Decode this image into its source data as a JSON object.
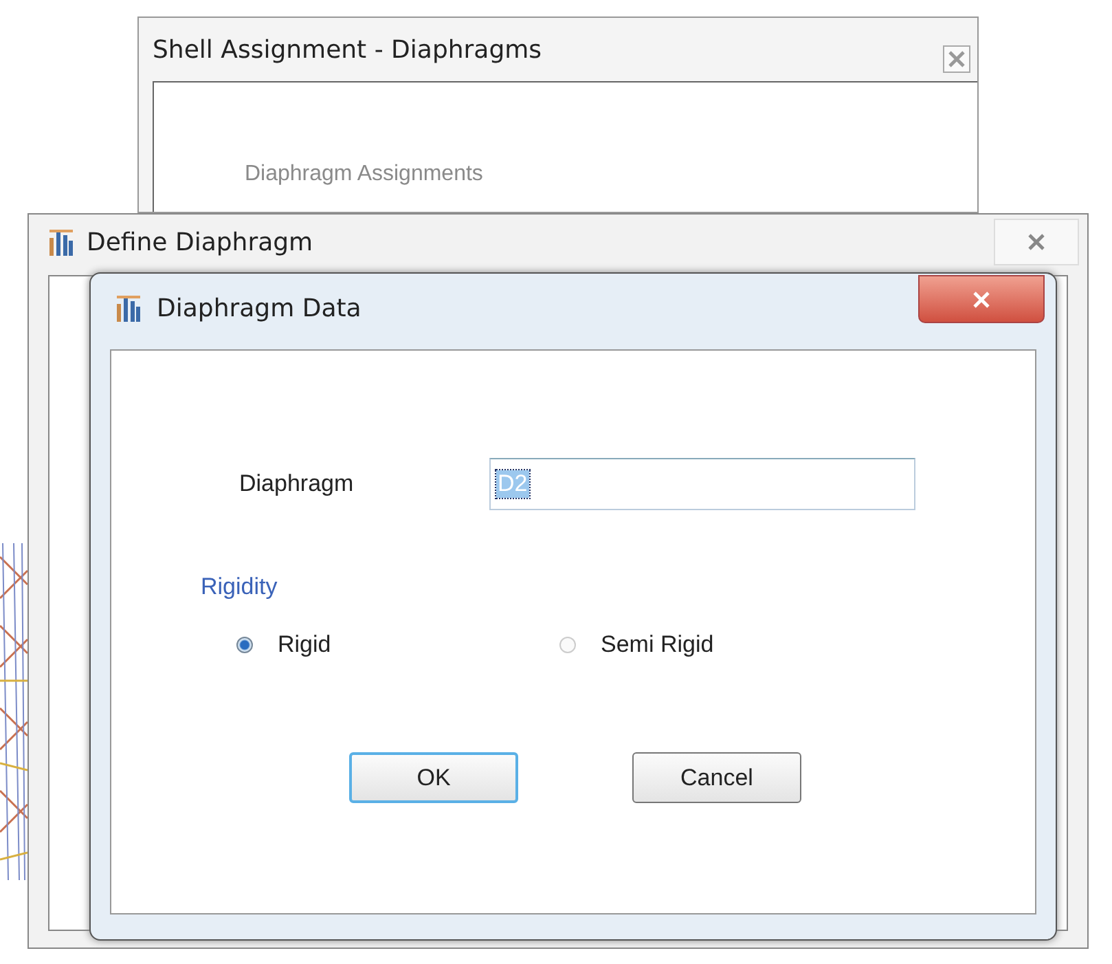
{
  "shell_assignment_window": {
    "title": "Shell Assignment - Diaphragms",
    "group_label": "Diaphragm Assignments"
  },
  "define_diaphragm_window": {
    "title": "Define Diaphragm"
  },
  "diaphragm_data_dialog": {
    "title": "Diaphragm Data",
    "diaphragm": {
      "label": "Diaphragm",
      "value": "D2",
      "text_selected": true
    },
    "rigidity": {
      "label": "Rigidity",
      "options": [
        {
          "label": "Rigid",
          "selected": true
        },
        {
          "label": "Semi Rigid",
          "selected": false
        }
      ]
    },
    "buttons": [
      {
        "label": "OK",
        "focused": true
      },
      {
        "label": "Cancel",
        "focused": false
      }
    ]
  }
}
